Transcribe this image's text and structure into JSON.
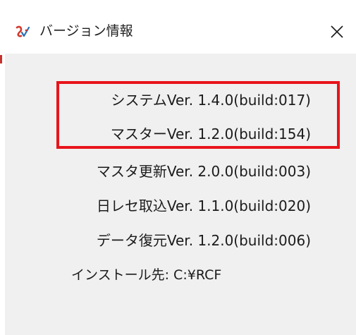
{
  "window": {
    "title": "バージョン情報",
    "close_symbol": "✕"
  },
  "versions": [
    {
      "label": "システムVer. 1.4.0(build:017)"
    },
    {
      "label": "マスターVer. 1.2.0(build:154)"
    },
    {
      "label": "マスタ更新Ver. 2.0.0(build:003)"
    },
    {
      "label": "日レセ取込Ver. 1.1.0(build:020)"
    },
    {
      "label": "データ復元Ver. 1.2.0(build:006)"
    }
  ],
  "install": {
    "label": "インストール先: C:¥RCF"
  },
  "colors": {
    "highlight": "#e8141b",
    "client_bg": "#f0f0f0",
    "icon_red": "#d43a2f",
    "icon_blue": "#2a6fb5"
  },
  "icons": {
    "app": "app-logo-icon",
    "close": "close-icon"
  }
}
